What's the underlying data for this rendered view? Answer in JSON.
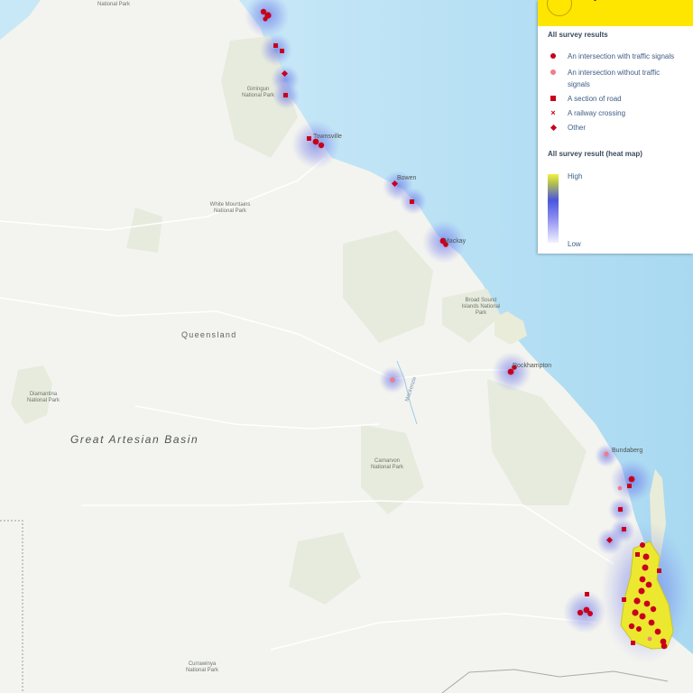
{
  "legend": {
    "survey_title": "All survey results",
    "items": [
      {
        "symbol": "circle",
        "label": "An intersection with traffic signals"
      },
      {
        "symbol": "circle-pink",
        "label": "An intersection without traffic signals"
      },
      {
        "symbol": "square",
        "label": "A section of road"
      },
      {
        "symbol": "cross",
        "label": "A railway crossing"
      },
      {
        "symbol": "diamond",
        "label": "Other"
      }
    ],
    "heatmap_title": "All survey result (heat map)",
    "heat_high": "High",
    "heat_low": "Low"
  },
  "map_labels": {
    "national_park_top": "National Park",
    "girringun": "Girringun National Park",
    "townsville": "Townsville",
    "white_mountains": "White Mountains National Park",
    "bowen": "Bowen",
    "mackay": "Mackay",
    "broad_sound": "Broad Sound Islands National Park",
    "queensland": "Queensland",
    "rockhampton": "Rockhampton",
    "mackenzie": "Mackenzie",
    "diamantina": "Diamantina National Park",
    "great_artesian": "Great Artesian Basin",
    "carnarvon": "Carnarvon National Park",
    "bundaberg": "Bundaberg",
    "currawinya": "Currawinya National Park"
  },
  "colors": {
    "land": "#f3f4ef",
    "water": "#bfe3f5",
    "marker": "#c8001d",
    "heat_high": "#f2ef3f",
    "heat_mid": "#4a55df",
    "legend_header": "#ffe600"
  }
}
